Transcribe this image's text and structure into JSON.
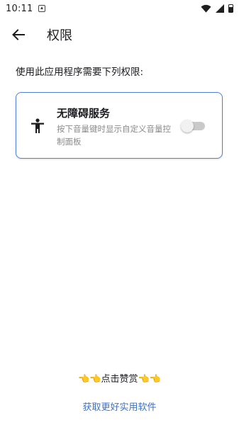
{
  "status_bar": {
    "time": "10:11"
  },
  "app_bar": {
    "title": "权限"
  },
  "intro": "使用此应用程序需要下列权限:",
  "permission": {
    "title": "无障碍服务",
    "description": "按下音量键时显示自定义音量控制面板",
    "enabled": false
  },
  "footer": {
    "praise_left": "👈👈",
    "praise_label": "点击赞赏",
    "praise_right": "👈👈",
    "more_apps_link": "获取更好实用软件"
  },
  "colors": {
    "accent": "#3d72c9",
    "card_border": "#4f81d8",
    "secondary_text": "#8a8a8a"
  },
  "icons": [
    "notification-icon",
    "wifi-icon",
    "signal-icon",
    "battery-icon",
    "back-arrow-icon",
    "accessibility-icon"
  ]
}
